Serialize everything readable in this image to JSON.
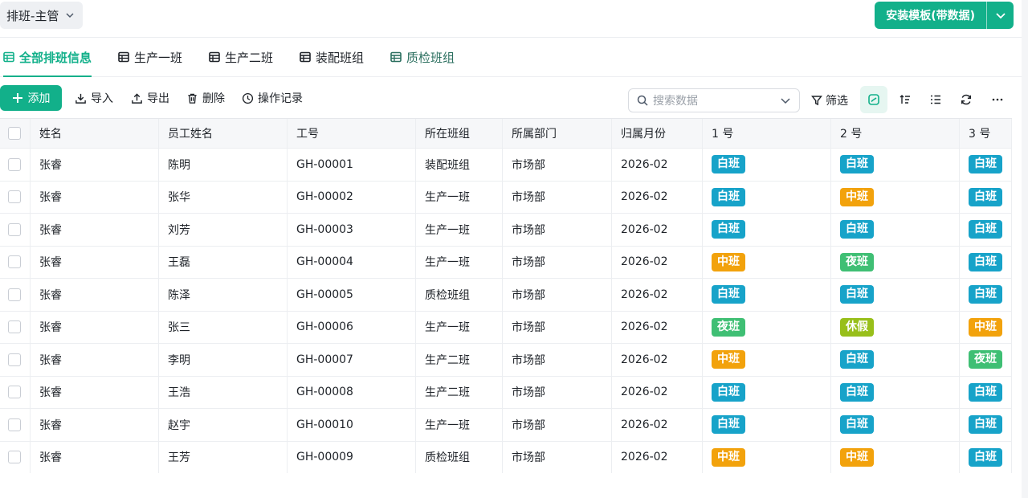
{
  "header": {
    "role_label": "排班-主管",
    "install_label": "安装模板(带数据)"
  },
  "tabs": [
    {
      "label": "全部排班信息",
      "active": true
    },
    {
      "label": "生产一班",
      "active": false
    },
    {
      "label": "生产二班",
      "active": false
    },
    {
      "label": "装配班组",
      "active": false
    },
    {
      "label": "质检班组",
      "active": false
    }
  ],
  "toolbar": {
    "add_label": "添加",
    "import_label": "导入",
    "export_label": "导出",
    "delete_label": "删除",
    "log_label": "操作记录",
    "search_placeholder": "搜索数据",
    "filter_label": "筛选"
  },
  "shift_colors": {
    "白班": "#17a3c9",
    "中班": "#f2a20c",
    "夜班": "#3fbf74",
    "休假": "#98bf1a"
  },
  "columns": [
    "姓名",
    "员工姓名",
    "工号",
    "所在班组",
    "所属部门",
    "归属月份",
    "1 号",
    "2 号",
    "3 号"
  ],
  "rows": [
    {
      "name": "张睿",
      "employee": "陈明",
      "id": "GH-00001",
      "group": "装配班组",
      "dept": "市场部",
      "month": "2026-02",
      "d1": "白班",
      "d2": "白班",
      "d3": "白班"
    },
    {
      "name": "张睿",
      "employee": "张华",
      "id": "GH-00002",
      "group": "生产一班",
      "dept": "市场部",
      "month": "2026-02",
      "d1": "白班",
      "d2": "中班",
      "d3": "白班"
    },
    {
      "name": "张睿",
      "employee": "刘芳",
      "id": "GH-00003",
      "group": "生产一班",
      "dept": "市场部",
      "month": "2026-02",
      "d1": "白班",
      "d2": "白班",
      "d3": "白班"
    },
    {
      "name": "张睿",
      "employee": "王磊",
      "id": "GH-00004",
      "group": "生产一班",
      "dept": "市场部",
      "month": "2026-02",
      "d1": "中班",
      "d2": "夜班",
      "d3": "白班"
    },
    {
      "name": "张睿",
      "employee": "陈泽",
      "id": "GH-00005",
      "group": "质检班组",
      "dept": "市场部",
      "month": "2026-02",
      "d1": "白班",
      "d2": "白班",
      "d3": "白班"
    },
    {
      "name": "张睿",
      "employee": "张三",
      "id": "GH-00006",
      "group": "生产一班",
      "dept": "市场部",
      "month": "2026-02",
      "d1": "夜班",
      "d2": "休假",
      "d3": "中班"
    },
    {
      "name": "张睿",
      "employee": "李明",
      "id": "GH-00007",
      "group": "生产二班",
      "dept": "市场部",
      "month": "2026-02",
      "d1": "中班",
      "d2": "白班",
      "d3": "夜班"
    },
    {
      "name": "张睿",
      "employee": "王浩",
      "id": "GH-00008",
      "group": "生产二班",
      "dept": "市场部",
      "month": "2026-02",
      "d1": "白班",
      "d2": "白班",
      "d3": "白班"
    },
    {
      "name": "张睿",
      "employee": "赵宇",
      "id": "GH-00010",
      "group": "生产一班",
      "dept": "市场部",
      "month": "2026-02",
      "d1": "白班",
      "d2": "白班",
      "d3": "白班"
    },
    {
      "name": "张睿",
      "employee": "王芳",
      "id": "GH-00009",
      "group": "质检班组",
      "dept": "市场部",
      "month": "2026-02",
      "d1": "中班",
      "d2": "中班",
      "d3": "白班"
    }
  ]
}
